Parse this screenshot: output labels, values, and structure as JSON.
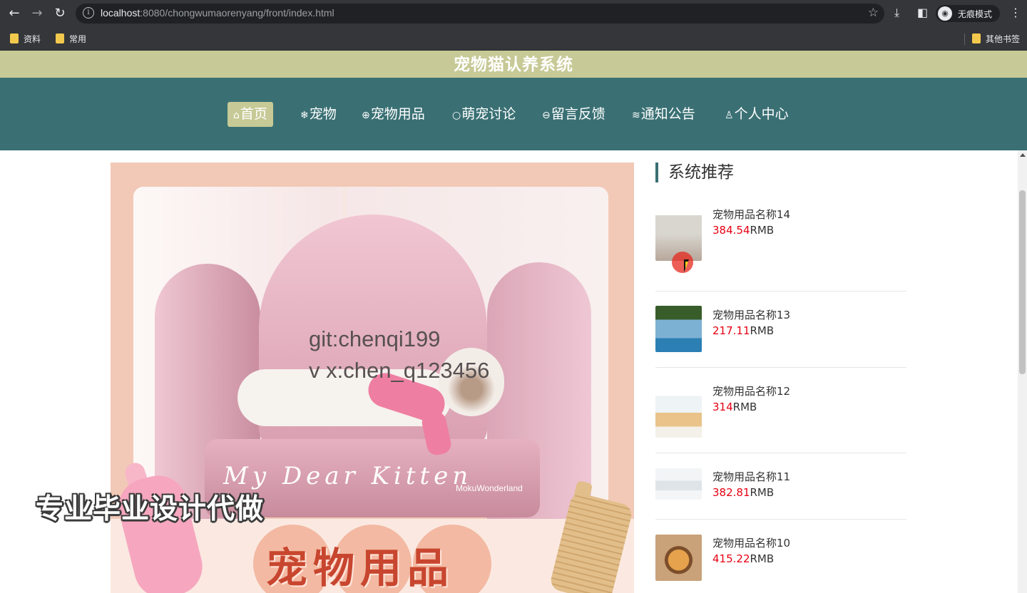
{
  "browser": {
    "url_host": "localhost",
    "url_rest": ":8080/chongwumaorenyang/front/index.html",
    "incognito_label": "无痕模式",
    "bookmarks": [
      "资料",
      "常用"
    ],
    "other_bookmarks": "其他书签",
    "icons": [
      "back-arrow-icon",
      "forward-arrow-icon",
      "reload-icon",
      "info-icon",
      "star-icon",
      "download-icon",
      "sidebar-icon",
      "incognito-icon",
      "more-vert-icon"
    ]
  },
  "site": {
    "title": "宠物猫认养系统",
    "nav": [
      {
        "label": "首页",
        "icon": "home-icon",
        "glyph": "⌂",
        "active": true
      },
      {
        "label": "宠物",
        "icon": "snowflake-icon",
        "glyph": "❄",
        "active": false
      },
      {
        "label": "宠物用品",
        "icon": "globe-icon",
        "glyph": "⊕",
        "active": false
      },
      {
        "label": "萌宠讨论",
        "icon": "chat-icon",
        "glyph": "○",
        "active": false
      },
      {
        "label": "留言反馈",
        "icon": "message-icon",
        "glyph": "⊖",
        "active": false
      },
      {
        "label": "通知公告",
        "icon": "layers-icon",
        "glyph": "≋",
        "active": false
      },
      {
        "label": "个人中心",
        "icon": "user-icon",
        "glyph": "♙",
        "active": false
      }
    ]
  },
  "banner": {
    "script_text": "My Dear Kitten",
    "brand_text": "MokuWonderland",
    "promo_text": "宠物用品"
  },
  "watermark": {
    "line1": "git:chenqi199",
    "line2": "v x:chen_q123456"
  },
  "overlay_ad": "专业毕业设计代做",
  "recommend": {
    "title": "系统推荐",
    "currency": "RMB",
    "items": [
      {
        "name": "宠物用品名称14",
        "price": "384.54"
      },
      {
        "name": "宠物用品名称13",
        "price": "217.11"
      },
      {
        "name": "宠物用品名称12",
        "price": "314"
      },
      {
        "name": "宠物用品名称11",
        "price": "382.81"
      },
      {
        "name": "宠物用品名称10",
        "price": "415.22"
      }
    ]
  },
  "colors": {
    "header_bg": "#c7c996",
    "nav_bg": "#3a7074",
    "price": "#e60012",
    "chrome_bg": "#35363a"
  }
}
